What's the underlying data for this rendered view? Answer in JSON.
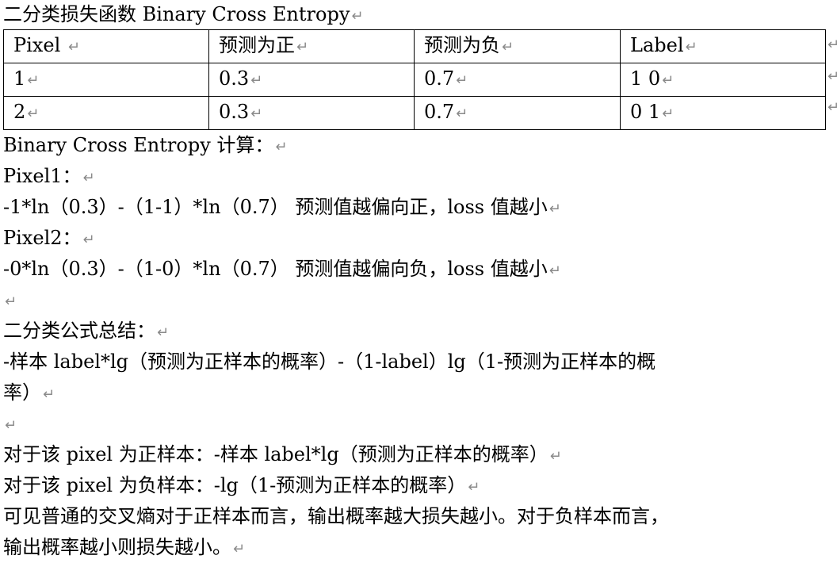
{
  "title": "二分类损失函数 Binary Cross Entropy",
  "return_mark": "↵",
  "table": {
    "header": [
      "Pixel ",
      "预测为正",
      "预测为负",
      "Label"
    ],
    "rows": [
      [
        "1",
        "0.3",
        "0.7",
        "1 0"
      ],
      [
        "2",
        "0.3",
        "0.7",
        "0 1"
      ]
    ]
  },
  "lines": [
    "Binary Cross Entropy 计算：",
    "Pixel1：",
    "-1*ln（0.3）-（1-1）*ln（0.7） 预测值越偏向正，loss 值越小",
    "Pixel2：",
    "-0*ln（0.3）-（1-0）*ln（0.7） 预测值越偏向负，loss 值越小",
    "",
    "二分类公式总结：",
    "-样本 label*lg（预测为正样本的概率）-（1-label）lg（1-预测为正样本的概",
    "率）",
    "",
    "对于该 pixel 为正样本：-样本 label*lg（预测为正样本的概率）",
    "对于该 pixel 为负样本：-lg（1-预测为正样本的概率）",
    "可见普通的交叉熵对于正样本而言，输出概率越大损失越小。对于负样本而言，",
    "输出概率越小则损失越小。"
  ]
}
